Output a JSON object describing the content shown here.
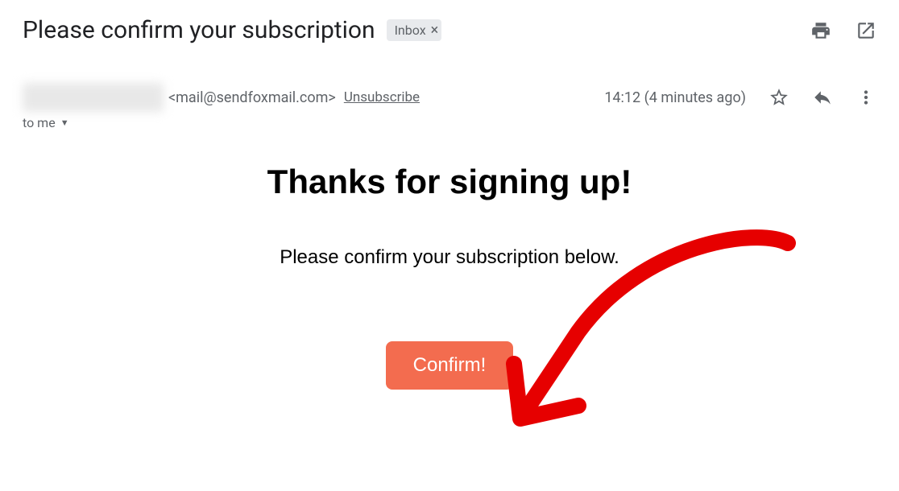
{
  "email": {
    "subject": "Please confirm your subscription",
    "label": "Inbox",
    "sender_email": "<mail@sendfoxmail.com>",
    "unsubscribe": "Unsubscribe",
    "timestamp": "14:12 (4 minutes ago)",
    "to_line": "to me"
  },
  "body": {
    "heading": "Thanks for signing up!",
    "text": "Please confirm your subscription below.",
    "button": "Confirm!"
  },
  "colors": {
    "button_bg": "#f36c4f"
  }
}
